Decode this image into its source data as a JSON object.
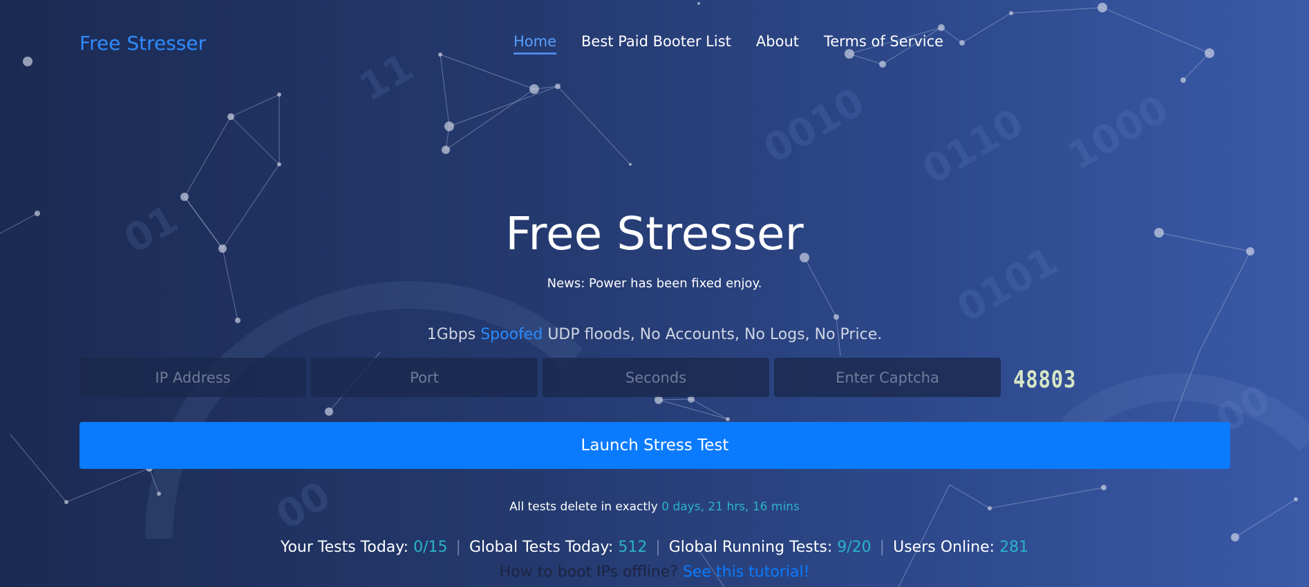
{
  "navbar": {
    "brand": "Free Stresser",
    "links": [
      "Home",
      "Best Paid Booter List",
      "About",
      "Terms of Service"
    ]
  },
  "hero": {
    "title": "Free Stresser",
    "news": "News: Power has been fixed enjoy.",
    "tagline_pre": "1Gbps",
    "tagline_highlight": "Spoofed",
    "tagline_post": "UDP floods, No Accounts, No Logs, No Price."
  },
  "form": {
    "ip_placeholder": "IP Address",
    "port_placeholder": "Port",
    "seconds_placeholder": "Seconds",
    "captcha_placeholder": "Enter Captcha",
    "captcha_code": "48803",
    "launch_label": "Launch Stress Test"
  },
  "delete_note": {
    "label": "All tests delete in exactly",
    "value": "0 days, 21 hrs, 16 mins"
  },
  "stats": {
    "your_label": "Your Tests Today:",
    "your_value": "0/15",
    "global_label": "Global Tests Today:",
    "global_value": "512",
    "running_label": "Global Running Tests:",
    "running_value": "9/20",
    "online_label": "Users Online:",
    "online_value": "281",
    "separator": "|"
  },
  "tutorial": {
    "label": "How to boot IPs offline?",
    "link": "See this tutorial!"
  },
  "colors": {
    "accent": "#0a7bff",
    "stat_value": "#2bb3c9",
    "captcha": "#d7e6c6"
  }
}
